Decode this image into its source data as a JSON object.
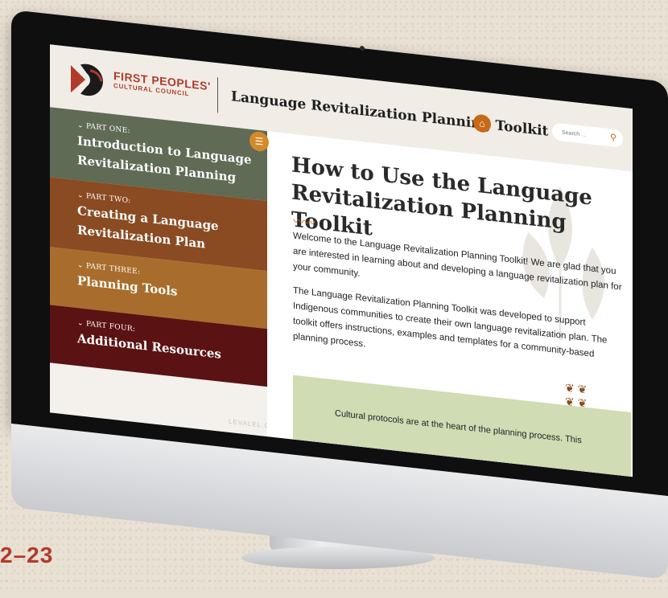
{
  "brand": {
    "logo_title": "FIRST PEOPLES'",
    "logo_subtitle": "CULTURAL COUNCIL",
    "site_title": "Language Revitalization Planning Toolkit"
  },
  "search": {
    "placeholder": "Search ..."
  },
  "sidebar": {
    "items": [
      {
        "part": "PART ONE:",
        "title_line1": "Introduction to Language",
        "title_line2": "Revitalization Planning",
        "color": "#5f6b54"
      },
      {
        "part": "PART TWO:",
        "title_line1": "Creating a Language",
        "title_line2": "Revitalization Plan",
        "color": "#8a4b22"
      },
      {
        "part": "PART THREE:",
        "title_line1": "Planning Tools",
        "title_line2": "",
        "color": "#a86d2c"
      },
      {
        "part": "PART FOUR:",
        "title_line1": "Additional Resources",
        "title_line2": "",
        "color": "#5a1212"
      }
    ],
    "footer_note": "LEVALEL.COM"
  },
  "main": {
    "heading": "How to Use the Language Revitalization Planning Toolkit",
    "intro": "Welcome to the Language Revitalization Planning Toolkit! We are glad that you are interested in learning about and developing a language revitalization plan for your community.",
    "body": "The Language Revitalization Planning Toolkit was developed to support Indigenous communities to create their own language revitalization plan. The toolkit offers instructions, examples and templates for a community-based planning process.",
    "callout": "Cultural protocols are at the heart of the planning process. This"
  },
  "caption_year": "2–23",
  "colors": {
    "accent": "#c66a17",
    "brand_red": "#b23a2b"
  }
}
